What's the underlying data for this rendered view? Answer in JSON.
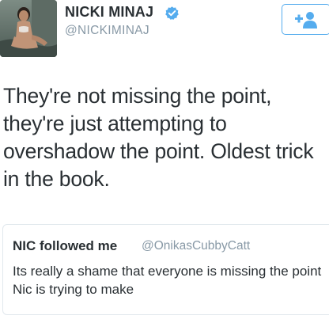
{
  "author": {
    "display_name": "NICKI MINAJ",
    "handle": "@NICKIMINAJ",
    "verified": true,
    "avatar_icon": "profile-photo"
  },
  "follow_button": {
    "icon": "follow-user-plus-icon",
    "color": "#55acee"
  },
  "tweet": {
    "text": "They're not missing the point,\nthey're just attempting to\novershadow the point. Oldest trick\nin the book."
  },
  "quoted_tweet": {
    "display_name": "NIC followed me",
    "handle": "@OnikasCubbyCatt",
    "text": "Its really a shame that everyone is missing the point Nic is trying to make"
  },
  "colors": {
    "text": "#292f33",
    "muted": "#8899a6",
    "accent": "#55acee",
    "border": "#e1e8ed"
  }
}
